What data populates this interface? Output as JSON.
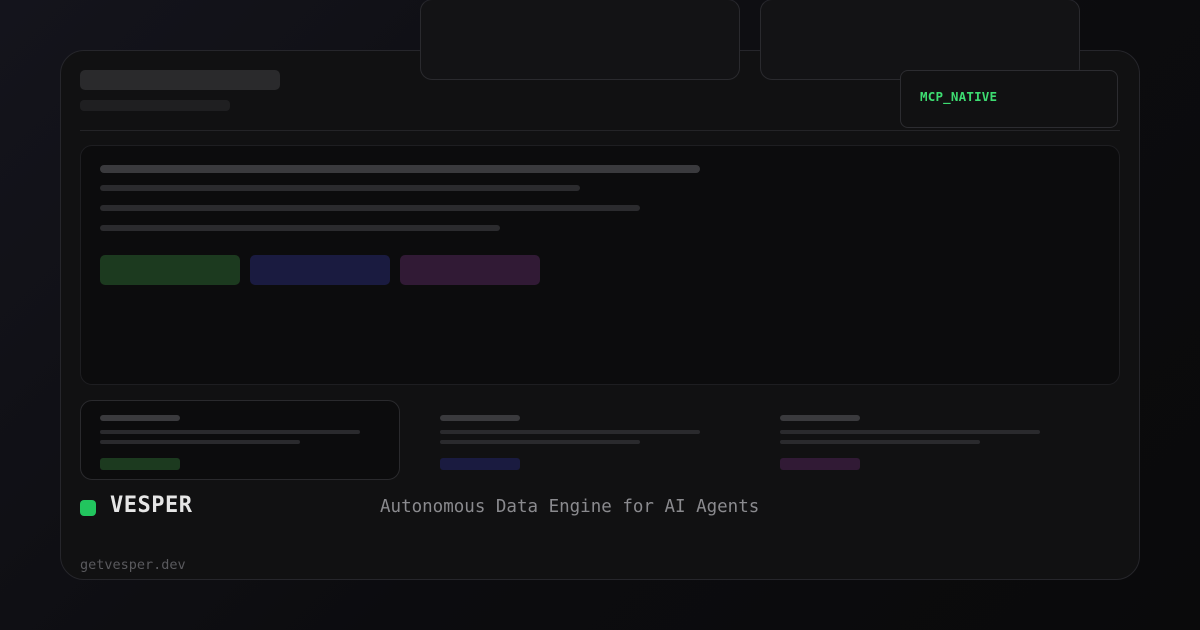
{
  "badge": {
    "label": "MCP_NATIVE",
    "color": "#3ddc71"
  },
  "brand": {
    "name": "VESPER",
    "tagline": "Autonomous Data Engine for AI Agents",
    "url": "getvesper.dev",
    "accent": "#22c55e"
  },
  "placeholders": {
    "action_colors": [
      "#1c3a1f",
      "#1a1b40",
      "#311a35"
    ],
    "feature_card_count": 3
  }
}
